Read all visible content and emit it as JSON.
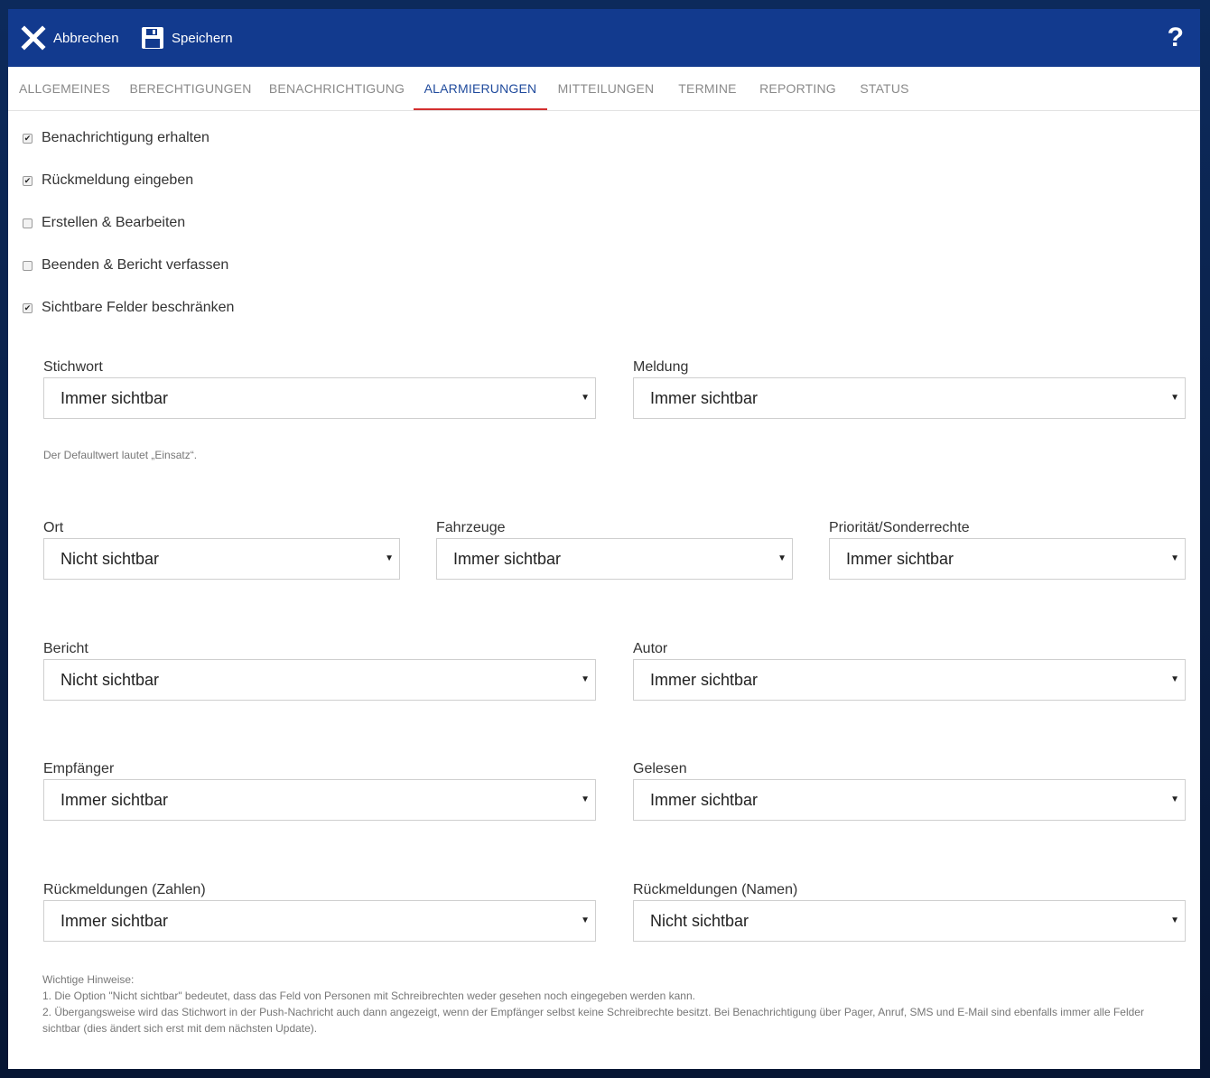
{
  "toolbar": {
    "cancel_label": "Abbrechen",
    "save_label": "Speichern",
    "help_label": "?"
  },
  "tabs": [
    {
      "label": "ALLGEMEINES",
      "active": false
    },
    {
      "label": "BERECHTIGUNGEN",
      "active": false
    },
    {
      "label": "BENACHRICHTIGUNG",
      "active": false
    },
    {
      "label": "ALARMIERUNGEN",
      "active": true
    },
    {
      "label": "MITTEILUNGEN",
      "active": false
    },
    {
      "label": "TERMINE",
      "active": false
    },
    {
      "label": "REPORTING",
      "active": false
    },
    {
      "label": "STATUS",
      "active": false
    }
  ],
  "checkboxes": [
    {
      "label": "Benachrichtigung erhalten",
      "checked": true
    },
    {
      "label": "Rückmeldung eingeben",
      "checked": true
    },
    {
      "label": "Erstellen & Bearbeiten",
      "checked": false
    },
    {
      "label": "Beenden & Bericht verfassen",
      "checked": false
    },
    {
      "label": "Sichtbare Felder beschränken",
      "checked": true
    }
  ],
  "fields": {
    "stichwort": {
      "label": "Stichwort",
      "value": "Immer sichtbar"
    },
    "meldung": {
      "label": "Meldung",
      "value": "Immer sichtbar"
    },
    "ort": {
      "label": "Ort",
      "value": "Nicht sichtbar"
    },
    "fahrzeuge": {
      "label": "Fahrzeuge",
      "value": "Immer sichtbar"
    },
    "prioritaet": {
      "label": "Priorität/Sonderrechte",
      "value": "Immer sichtbar"
    },
    "bericht": {
      "label": "Bericht",
      "value": "Nicht sichtbar"
    },
    "autor": {
      "label": "Autor",
      "value": "Immer sichtbar"
    },
    "empfaenger": {
      "label": "Empfänger",
      "value": "Immer sichtbar"
    },
    "gelesen": {
      "label": "Gelesen",
      "value": "Immer sichtbar"
    },
    "rm_zahlen": {
      "label": "Rückmeldungen (Zahlen)",
      "value": "Immer sichtbar"
    },
    "rm_namen": {
      "label": "Rückmeldungen (Namen)",
      "value": "Nicht sichtbar"
    }
  },
  "default_hint": "Der Defaultwert lautet „Einsatz“.",
  "notes": {
    "title": "Wichtige Hinweise:",
    "line1": "1. Die Option \"Nicht sichtbar\" bedeutet, dass das Feld von Personen mit Schreibrechten weder gesehen noch eingegeben werden kann.",
    "line2": "2. Übergangsweise wird das Stichwort in der Push-Nachricht auch dann angezeigt, wenn der Empfänger selbst keine Schreibrechte besitzt. Bei Benachrichtigung über Pager, Anruf, SMS und E-Mail sind ebenfalls immer alle Felder sichtbar (dies ändert sich erst mit dem nächsten Update)."
  },
  "colors": {
    "toolbar": "#123a8e",
    "active_tab_text": "#1f4a9c",
    "active_tab_underline": "#d32f2f"
  }
}
